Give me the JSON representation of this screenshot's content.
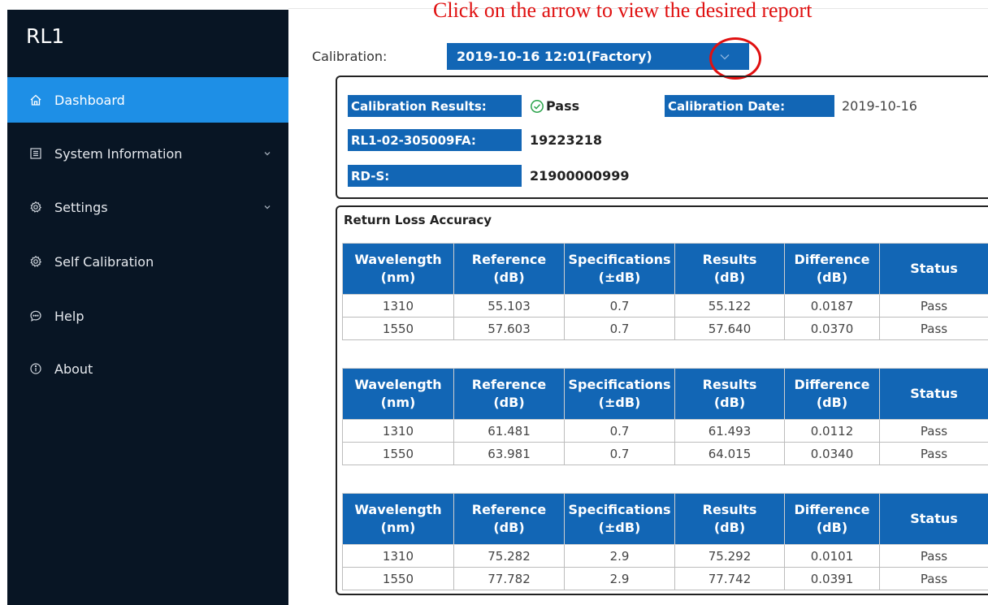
{
  "annotation": "Click on the arrow to view the desired report",
  "sidebar": {
    "brand": "RL1",
    "items": [
      {
        "label": "Dashboard",
        "icon": "home-icon",
        "active": true
      },
      {
        "label": "System Information",
        "icon": "list-icon",
        "has_submenu": true
      },
      {
        "label": "Settings",
        "icon": "gear-icon",
        "has_submenu": true
      },
      {
        "label": "Self Calibration",
        "icon": "gear-icon"
      },
      {
        "label": "Help",
        "icon": "chat-icon"
      },
      {
        "label": "About",
        "icon": "info-icon"
      }
    ]
  },
  "calibration": {
    "label": "Calibration:",
    "selected": "2019-10-16 12:01(Factory)"
  },
  "info": {
    "results_label": "Calibration Results:",
    "results_value": "Pass",
    "date_label": "Calibration Date:",
    "date_value": "2019-10-16",
    "device_label": "RL1-02-305009FA:",
    "device_value": "19223218",
    "rds_label": "RD-S:",
    "rds_value": "21900000999"
  },
  "return_loss": {
    "title": "Return Loss Accuracy",
    "headers": [
      [
        "Wavelength",
        "(nm)"
      ],
      [
        "Reference",
        "(dB)"
      ],
      [
        "Specifications",
        "(±dB)"
      ],
      [
        "Results",
        "(dB)"
      ],
      [
        "Difference",
        "(dB)"
      ],
      [
        "Status"
      ]
    ],
    "tables": [
      {
        "rows": [
          [
            "1310",
            "55.103",
            "0.7",
            "55.122",
            "0.0187",
            "Pass"
          ],
          [
            "1550",
            "57.603",
            "0.7",
            "57.640",
            "0.0370",
            "Pass"
          ]
        ]
      },
      {
        "rows": [
          [
            "1310",
            "61.481",
            "0.7",
            "61.493",
            "0.0112",
            "Pass"
          ],
          [
            "1550",
            "63.981",
            "0.7",
            "64.015",
            "0.0340",
            "Pass"
          ]
        ]
      },
      {
        "rows": [
          [
            "1310",
            "75.282",
            "2.9",
            "75.292",
            "0.0101",
            "Pass"
          ],
          [
            "1550",
            "77.782",
            "2.9",
            "77.742",
            "0.0391",
            "Pass"
          ]
        ]
      }
    ]
  },
  "colors": {
    "sidebar_bg": "#081524",
    "active_bg": "#1e8fe6",
    "accent_blue": "#1266b5",
    "annotation_red": "#e01010",
    "pass_green": "#2aa34a"
  }
}
